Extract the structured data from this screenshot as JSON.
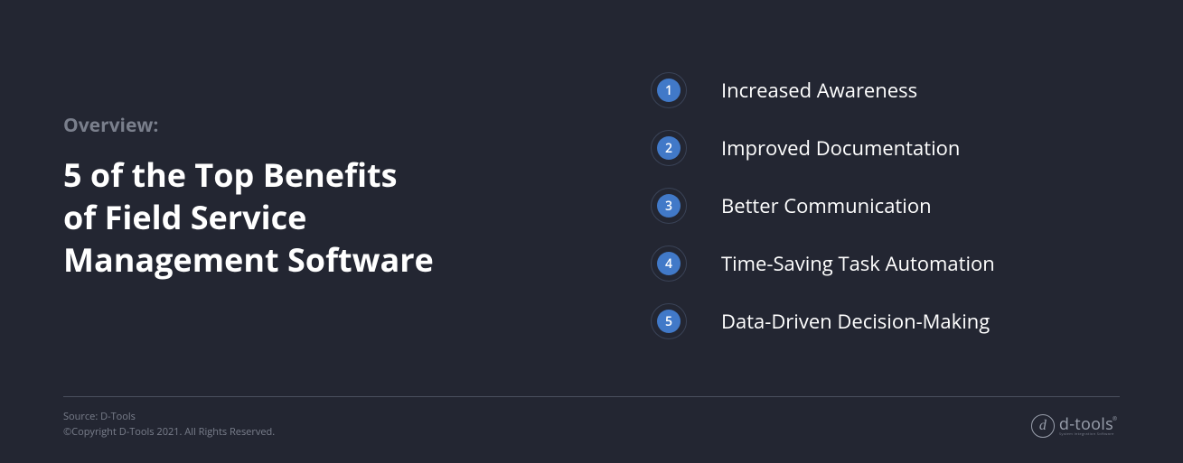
{
  "overview_label": "Overview:",
  "main_title_line1": "5 of the Top Benefits",
  "main_title_line2": "of Field Service",
  "main_title_line3": "Management Software",
  "benefits": [
    {
      "num": "1",
      "text": "Increased Awareness"
    },
    {
      "num": "2",
      "text": "Improved Documentation"
    },
    {
      "num": "3",
      "text": "Better Communication"
    },
    {
      "num": "4",
      "text": "Time-Saving Task Automation"
    },
    {
      "num": "5",
      "text": "Data-Driven Decision-Making"
    }
  ],
  "footer": {
    "source": "Source: D-Tools",
    "copyright": "©Copyright D-Tools 2021. All Rights Reserved."
  },
  "logo": {
    "letter": "d",
    "text": "d-tools",
    "sub": "System Integration Software",
    "reg": "®"
  }
}
